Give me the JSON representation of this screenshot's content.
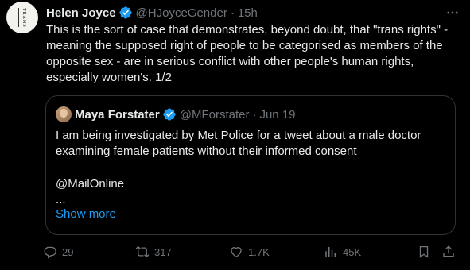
{
  "avatar": {
    "text": "TRANS"
  },
  "tweet": {
    "author_name": "Helen Joyce",
    "handle": "@HJoyceGender",
    "separator": "·",
    "time": "15h",
    "text": "This is the sort of case that demonstrates, beyond doubt, that \"trans rights\" - meaning the supposed right of people to be categorised as members of the opposite sex - are in serious conflict with other people's human rights, especially women's. 1/2"
  },
  "quote": {
    "author_name": "Maya Forstater",
    "handle": "@MForstater",
    "separator": "·",
    "time": "Jun 19",
    "text": "I am being investigated by Met Police for a tweet about a male doctor examining female patients without their informed consent",
    "mention": "@MailOnline",
    "ellipsis": "...",
    "show_more": "Show more"
  },
  "actions": {
    "replies": "29",
    "retweets": "317",
    "likes": "1.7K",
    "views": "45K"
  },
  "colors": {
    "background": "#000000",
    "text": "#e7e9ea",
    "muted": "#71767b",
    "accent": "#1d9bf0",
    "border": "#2f3336"
  }
}
